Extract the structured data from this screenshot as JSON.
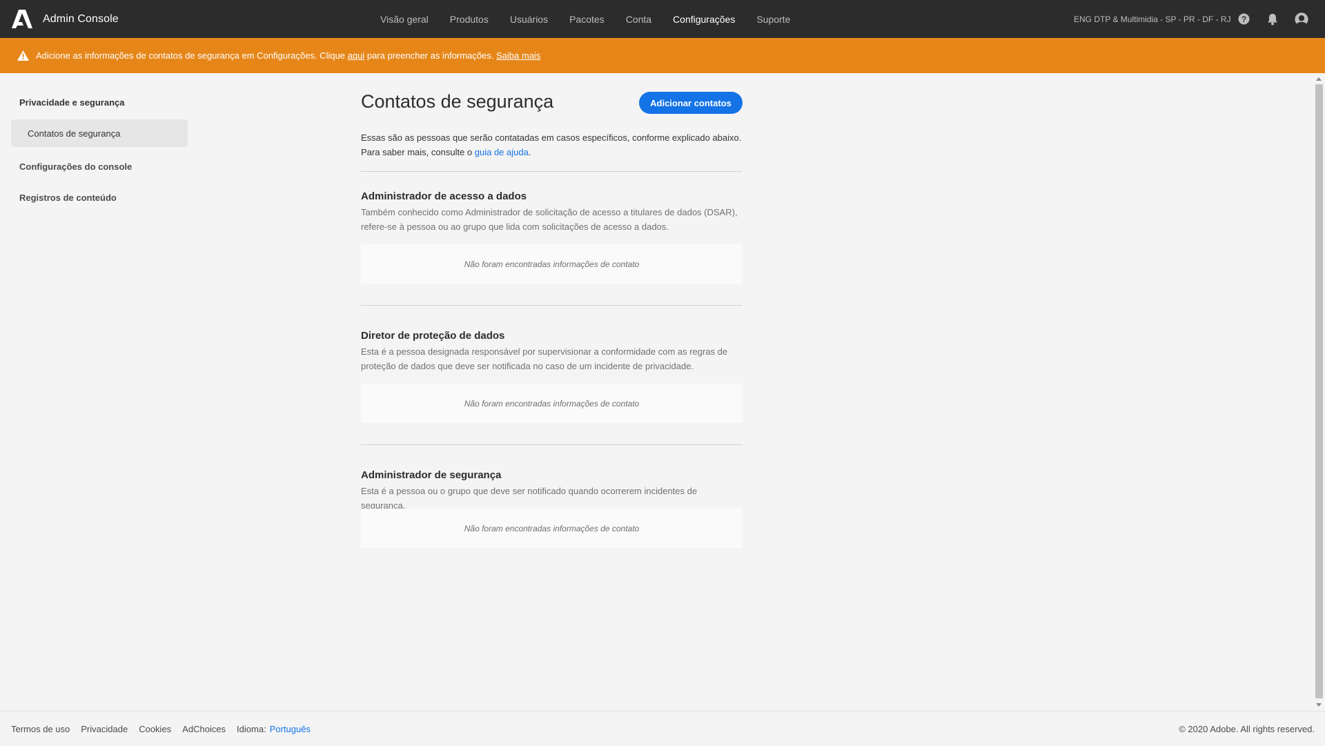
{
  "header": {
    "app_title": "Admin Console",
    "logo_icon": "adobe-logo",
    "nav": [
      {
        "label": "Visão geral",
        "active": false
      },
      {
        "label": "Produtos",
        "active": false
      },
      {
        "label": "Usuários",
        "active": false
      },
      {
        "label": "Pacotes",
        "active": false
      },
      {
        "label": "Conta",
        "active": false
      },
      {
        "label": "Configurações",
        "active": true
      },
      {
        "label": "Suporte",
        "active": false
      }
    ],
    "org_name": "ENG DTP & Multimidia - SP - PR - DF - RJ",
    "icons": [
      "help-icon",
      "bell-icon",
      "avatar-icon"
    ]
  },
  "banner": {
    "icon": "warning-icon",
    "text_before": "Adicione as informações de contatos de segurança em Configurações. Clique ",
    "link_here": "aqui",
    "text_after": " para preencher as informações. ",
    "link_learn": "Saiba mais",
    "color": "#e68619"
  },
  "sidebar": {
    "heading": "Privacidade e segurança",
    "active_item": "Contatos de segurança",
    "items": [
      "Configurações do console",
      "Registros de conteúdo"
    ]
  },
  "main": {
    "title": "Contatos de segurança",
    "add_button": "Adicionar contatos",
    "intro_text": "Essas são as pessoas que serão contatadas em casos específicos, conforme explicado abaixo. Para saber mais, consulte o ",
    "intro_link": "guia de ajuda",
    "intro_end": ".",
    "sections": [
      {
        "title": "Administrador de acesso a dados",
        "description": "Também conhecido como Administrador de solicitação de acesso a titulares de dados (DSAR), refere-se à pessoa ou ao grupo que lida com solicitações de acesso a dados.",
        "empty": "Não foram encontradas informações de contato"
      },
      {
        "title": "Diretor de proteção de dados",
        "description": "Esta é a pessoa designada responsável por supervisionar a conformidade com as regras de proteção de dados que deve ser notificada no caso de um incidente de privacidade.",
        "empty": "Não foram encontradas informações de contato"
      },
      {
        "title": "Administrador de segurança",
        "description": "Esta é a pessoa ou o grupo que deve ser notificado quando ocorrerem incidentes de segurança.",
        "empty": "Não foram encontradas informações de contato"
      }
    ]
  },
  "footer": {
    "links": [
      "Termos de uso",
      "Privacidade",
      "Cookies",
      "AdChoices"
    ],
    "language_label": "Idioma:",
    "language_value": "Português",
    "copyright": "© 2020 Adobe. All rights reserved."
  },
  "colors": {
    "accent": "#1473e6",
    "topbar": "#2c2c2c",
    "banner": "#e68619"
  }
}
